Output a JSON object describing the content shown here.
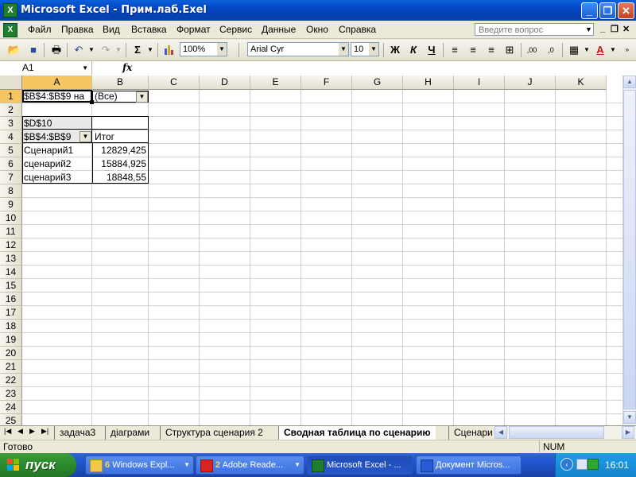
{
  "window": {
    "title": "Microsoft Excel - Прим.лаб.Exel",
    "app_icon": "excel-icon"
  },
  "menu": {
    "items": [
      "Файл",
      "Правка",
      "Вид",
      "Вставка",
      "Формат",
      "Сервис",
      "Данные",
      "Окно",
      "Справка"
    ],
    "ask_placeholder": "Введите вопрос"
  },
  "toolbar": {
    "zoom": "100%",
    "font_name": "Arial Cyr",
    "font_size": "10",
    "bold": "Ж",
    "italic": "К",
    "underline": "Ч",
    "sum_symbol": "Σ",
    "fx_symbol": "fx"
  },
  "formula_bar": {
    "name_box": "A1",
    "fx": "fx",
    "content": ""
  },
  "grid": {
    "columns": [
      "A",
      "B",
      "C",
      "D",
      "E",
      "F",
      "G",
      "H",
      "I",
      "J",
      "K"
    ],
    "rows": [
      "1",
      "2",
      "3",
      "4",
      "5",
      "6",
      "7",
      "8",
      "9",
      "10",
      "11",
      "12",
      "13",
      "14",
      "15",
      "16",
      "17",
      "18",
      "19",
      "20",
      "21",
      "22",
      "23",
      "24",
      "25"
    ],
    "cells": {
      "A1": "$B$4:$B$9 на",
      "B1": "(Все)",
      "A3": "$D$10",
      "A4": "$B$4:$B$9",
      "B4": "Итог",
      "A5": "Сценарий1",
      "B5": "12829,425",
      "A6": "сценарий2",
      "B6": "15884,925",
      "A7": "сценарий3",
      "B7": "18848,55"
    }
  },
  "sheet_tabs": [
    "задача3",
    "діаграми",
    "Структура сценария 2",
    "Сводная таблица по сценарию",
    "Сценари"
  ],
  "active_tab": "Сводная таблица по сценарию",
  "status": {
    "text": "Готово",
    "num": "NUM"
  },
  "taskbar": {
    "start": "пуск",
    "buttons": [
      {
        "count": "6",
        "label": "Windows Expl..."
      },
      {
        "count": "2",
        "label": "Adobe Reade..."
      },
      {
        "count": "",
        "label": "Microsoft Excel - ..."
      },
      {
        "count": "",
        "label": "Документ Micros..."
      }
    ],
    "clock": "16:01"
  },
  "colors": {
    "accent": "#0a5fd8",
    "selection": "#f6c662",
    "start": "#2b8a2b",
    "tray": "#1483d0"
  }
}
